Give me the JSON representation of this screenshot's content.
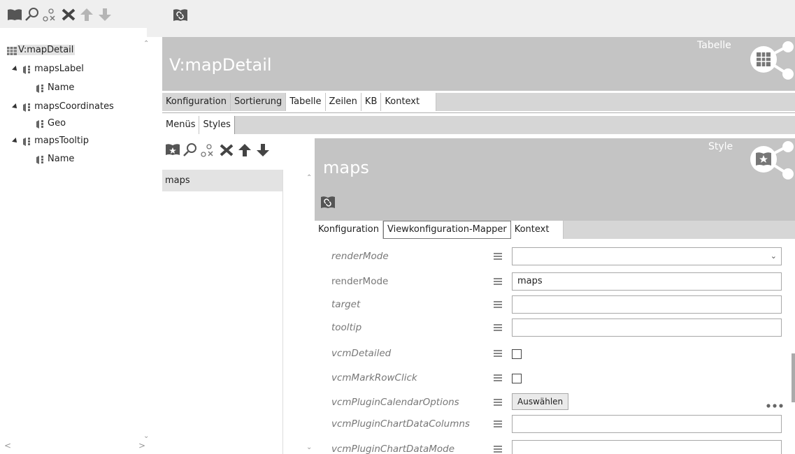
{
  "toolbar_left": {
    "icons": [
      "book-icon",
      "search-icon",
      "link-icon",
      "delete-icon",
      "move-up-icon",
      "move-down-icon"
    ]
  },
  "toolbar_top": {
    "icons": [
      "plugin-icon"
    ]
  },
  "tree": {
    "root": "V:mapDetail",
    "items": [
      {
        "label": "mapsLabel"
      },
      {
        "label": "Name"
      },
      {
        "label": "mapsCoordinates"
      },
      {
        "label": "Geo"
      },
      {
        "label": "mapsTooltip"
      },
      {
        "label": "Name"
      }
    ]
  },
  "header": {
    "title": "V:mapDetail",
    "type_label": "Tabelle",
    "tabs": [
      "Konfiguration",
      "Sortierung",
      "Tabelle",
      "Zeilen",
      "KB",
      "Kontext"
    ],
    "active_tab": "Tabelle",
    "subtabs": [
      "Menüs",
      "Styles"
    ],
    "active_subtab": "Styles"
  },
  "styles_list": {
    "items": [
      "maps"
    ]
  },
  "style_panel": {
    "title": "maps",
    "type_label": "Style",
    "tabs": [
      "Konfiguration",
      "Viewkonfiguration-Mapper",
      "Kontext"
    ],
    "active_tab": "Viewkonfiguration-Mapper",
    "properties": [
      {
        "name": "renderMode",
        "kind": "select",
        "value": ""
      },
      {
        "name": "renderMode",
        "kind": "text",
        "value": "maps"
      },
      {
        "name": "target",
        "kind": "text",
        "value": ""
      },
      {
        "name": "tooltip",
        "kind": "text",
        "value": ""
      },
      {
        "name": "vcmDetailed",
        "kind": "checkbox",
        "value": ""
      },
      {
        "name": "vcmMarkRowClick",
        "kind": "checkbox",
        "value": ""
      },
      {
        "name": "vcmPluginCalendarOptions",
        "kind": "button",
        "value": "Auswählen"
      },
      {
        "name": "vcmPluginChartDataColumns",
        "kind": "text",
        "value": ""
      },
      {
        "name": "vcmPluginChartDataMode",
        "kind": "text",
        "value": ""
      }
    ]
  },
  "colors": {
    "header_gray": "#c4c4c4",
    "tab_bar_gray": "#d6d6d6",
    "icon_dark": "#555555",
    "icon_light": "#b5b5b5"
  }
}
